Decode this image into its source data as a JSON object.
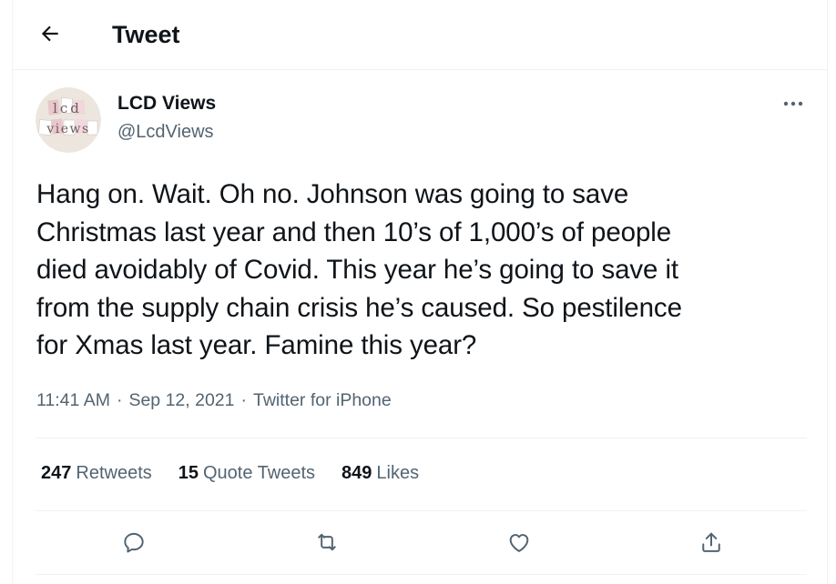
{
  "header": {
    "back_icon": "arrow-left-icon",
    "title": "Tweet"
  },
  "tweet": {
    "author": {
      "avatar_text_top": "lcd",
      "avatar_text_bottom": "views",
      "display_name": "LCD Views",
      "handle": "@LcdViews"
    },
    "more_icon": "more-horizontal-icon",
    "text": "Hang on. Wait. Oh no. Johnson was going to save\nChristmas last year and then 10’s of 1,000’s of people\ndied avoidably of Covid. This year he’s going to save it\nfrom the supply chain crisis he’s caused. So pestilence\nfor Xmas last year. Famine this year?",
    "time": "11:41 AM",
    "separator": "·",
    "date": "Sep 12, 2021",
    "source": "Twitter for iPhone"
  },
  "stats": {
    "retweets": {
      "count": "247",
      "label": "Retweets"
    },
    "quotes": {
      "count": "15",
      "label": "Quote Tweets"
    },
    "likes": {
      "count": "849",
      "label": "Likes"
    }
  },
  "actions": [
    {
      "icon": "reply-icon"
    },
    {
      "icon": "retweet-icon"
    },
    {
      "icon": "like-icon"
    },
    {
      "icon": "share-icon"
    }
  ],
  "colors": {
    "text_primary": "#0f1419",
    "text_secondary": "#536471",
    "border": "#eff3f4"
  }
}
